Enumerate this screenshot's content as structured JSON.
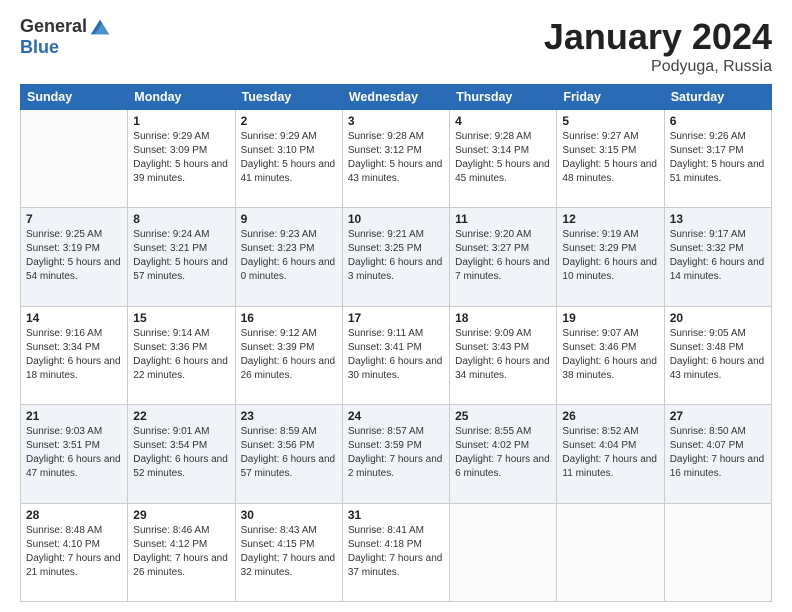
{
  "header": {
    "logo_general": "General",
    "logo_blue": "Blue",
    "month": "January 2024",
    "location": "Podyuga, Russia"
  },
  "weekdays": [
    "Sunday",
    "Monday",
    "Tuesday",
    "Wednesday",
    "Thursday",
    "Friday",
    "Saturday"
  ],
  "weeks": [
    [
      {
        "day": "",
        "sunrise": "",
        "sunset": "",
        "daylight": ""
      },
      {
        "day": "1",
        "sunrise": "Sunrise: 9:29 AM",
        "sunset": "Sunset: 3:09 PM",
        "daylight": "Daylight: 5 hours and 39 minutes."
      },
      {
        "day": "2",
        "sunrise": "Sunrise: 9:29 AM",
        "sunset": "Sunset: 3:10 PM",
        "daylight": "Daylight: 5 hours and 41 minutes."
      },
      {
        "day": "3",
        "sunrise": "Sunrise: 9:28 AM",
        "sunset": "Sunset: 3:12 PM",
        "daylight": "Daylight: 5 hours and 43 minutes."
      },
      {
        "day": "4",
        "sunrise": "Sunrise: 9:28 AM",
        "sunset": "Sunset: 3:14 PM",
        "daylight": "Daylight: 5 hours and 45 minutes."
      },
      {
        "day": "5",
        "sunrise": "Sunrise: 9:27 AM",
        "sunset": "Sunset: 3:15 PM",
        "daylight": "Daylight: 5 hours and 48 minutes."
      },
      {
        "day": "6",
        "sunrise": "Sunrise: 9:26 AM",
        "sunset": "Sunset: 3:17 PM",
        "daylight": "Daylight: 5 hours and 51 minutes."
      }
    ],
    [
      {
        "day": "7",
        "sunrise": "Sunrise: 9:25 AM",
        "sunset": "Sunset: 3:19 PM",
        "daylight": "Daylight: 5 hours and 54 minutes."
      },
      {
        "day": "8",
        "sunrise": "Sunrise: 9:24 AM",
        "sunset": "Sunset: 3:21 PM",
        "daylight": "Daylight: 5 hours and 57 minutes."
      },
      {
        "day": "9",
        "sunrise": "Sunrise: 9:23 AM",
        "sunset": "Sunset: 3:23 PM",
        "daylight": "Daylight: 6 hours and 0 minutes."
      },
      {
        "day": "10",
        "sunrise": "Sunrise: 9:21 AM",
        "sunset": "Sunset: 3:25 PM",
        "daylight": "Daylight: 6 hours and 3 minutes."
      },
      {
        "day": "11",
        "sunrise": "Sunrise: 9:20 AM",
        "sunset": "Sunset: 3:27 PM",
        "daylight": "Daylight: 6 hours and 7 minutes."
      },
      {
        "day": "12",
        "sunrise": "Sunrise: 9:19 AM",
        "sunset": "Sunset: 3:29 PM",
        "daylight": "Daylight: 6 hours and 10 minutes."
      },
      {
        "day": "13",
        "sunrise": "Sunrise: 9:17 AM",
        "sunset": "Sunset: 3:32 PM",
        "daylight": "Daylight: 6 hours and 14 minutes."
      }
    ],
    [
      {
        "day": "14",
        "sunrise": "Sunrise: 9:16 AM",
        "sunset": "Sunset: 3:34 PM",
        "daylight": "Daylight: 6 hours and 18 minutes."
      },
      {
        "day": "15",
        "sunrise": "Sunrise: 9:14 AM",
        "sunset": "Sunset: 3:36 PM",
        "daylight": "Daylight: 6 hours and 22 minutes."
      },
      {
        "day": "16",
        "sunrise": "Sunrise: 9:12 AM",
        "sunset": "Sunset: 3:39 PM",
        "daylight": "Daylight: 6 hours and 26 minutes."
      },
      {
        "day": "17",
        "sunrise": "Sunrise: 9:11 AM",
        "sunset": "Sunset: 3:41 PM",
        "daylight": "Daylight: 6 hours and 30 minutes."
      },
      {
        "day": "18",
        "sunrise": "Sunrise: 9:09 AM",
        "sunset": "Sunset: 3:43 PM",
        "daylight": "Daylight: 6 hours and 34 minutes."
      },
      {
        "day": "19",
        "sunrise": "Sunrise: 9:07 AM",
        "sunset": "Sunset: 3:46 PM",
        "daylight": "Daylight: 6 hours and 38 minutes."
      },
      {
        "day": "20",
        "sunrise": "Sunrise: 9:05 AM",
        "sunset": "Sunset: 3:48 PM",
        "daylight": "Daylight: 6 hours and 43 minutes."
      }
    ],
    [
      {
        "day": "21",
        "sunrise": "Sunrise: 9:03 AM",
        "sunset": "Sunset: 3:51 PM",
        "daylight": "Daylight: 6 hours and 47 minutes."
      },
      {
        "day": "22",
        "sunrise": "Sunrise: 9:01 AM",
        "sunset": "Sunset: 3:54 PM",
        "daylight": "Daylight: 6 hours and 52 minutes."
      },
      {
        "day": "23",
        "sunrise": "Sunrise: 8:59 AM",
        "sunset": "Sunset: 3:56 PM",
        "daylight": "Daylight: 6 hours and 57 minutes."
      },
      {
        "day": "24",
        "sunrise": "Sunrise: 8:57 AM",
        "sunset": "Sunset: 3:59 PM",
        "daylight": "Daylight: 7 hours and 2 minutes."
      },
      {
        "day": "25",
        "sunrise": "Sunrise: 8:55 AM",
        "sunset": "Sunset: 4:02 PM",
        "daylight": "Daylight: 7 hours and 6 minutes."
      },
      {
        "day": "26",
        "sunrise": "Sunrise: 8:52 AM",
        "sunset": "Sunset: 4:04 PM",
        "daylight": "Daylight: 7 hours and 11 minutes."
      },
      {
        "day": "27",
        "sunrise": "Sunrise: 8:50 AM",
        "sunset": "Sunset: 4:07 PM",
        "daylight": "Daylight: 7 hours and 16 minutes."
      }
    ],
    [
      {
        "day": "28",
        "sunrise": "Sunrise: 8:48 AM",
        "sunset": "Sunset: 4:10 PM",
        "daylight": "Daylight: 7 hours and 21 minutes."
      },
      {
        "day": "29",
        "sunrise": "Sunrise: 8:46 AM",
        "sunset": "Sunset: 4:12 PM",
        "daylight": "Daylight: 7 hours and 26 minutes."
      },
      {
        "day": "30",
        "sunrise": "Sunrise: 8:43 AM",
        "sunset": "Sunset: 4:15 PM",
        "daylight": "Daylight: 7 hours and 32 minutes."
      },
      {
        "day": "31",
        "sunrise": "Sunrise: 8:41 AM",
        "sunset": "Sunset: 4:18 PM",
        "daylight": "Daylight: 7 hours and 37 minutes."
      },
      {
        "day": "",
        "sunrise": "",
        "sunset": "",
        "daylight": ""
      },
      {
        "day": "",
        "sunrise": "",
        "sunset": "",
        "daylight": ""
      },
      {
        "day": "",
        "sunrise": "",
        "sunset": "",
        "daylight": ""
      }
    ]
  ]
}
